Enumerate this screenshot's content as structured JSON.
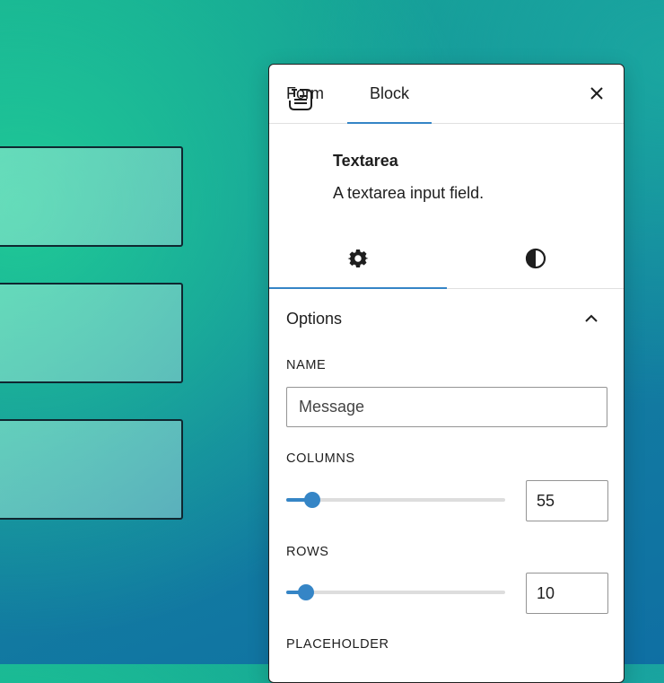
{
  "panel": {
    "tabs": [
      {
        "label": "Form"
      },
      {
        "label": "Block"
      }
    ],
    "active_tab": "Block",
    "close_icon": "close-icon",
    "block": {
      "icon": "textarea-block-icon",
      "title": "Textarea",
      "description": "A textarea input field."
    },
    "subtabs": [
      {
        "icon": "gear-icon",
        "active": true
      },
      {
        "icon": "half-circle-contrast-icon",
        "active": false
      }
    ],
    "options": {
      "title": "Options",
      "toggle_icon": "chevron-up-icon",
      "name": {
        "label": "NAME",
        "value": "Message"
      },
      "columns": {
        "label": "COLUMNS",
        "value": "55",
        "slider_fraction": 0.12
      },
      "rows": {
        "label": "ROWS",
        "value": "10",
        "slider_fraction": 0.09
      },
      "placeholder": {
        "label": "PLACEHOLDER"
      }
    }
  },
  "colors": {
    "accent": "#3585c6",
    "text": "#1e1e1e",
    "border": "#949494",
    "background_top": "#15a992",
    "background_bottom": "#0f6fa3"
  }
}
